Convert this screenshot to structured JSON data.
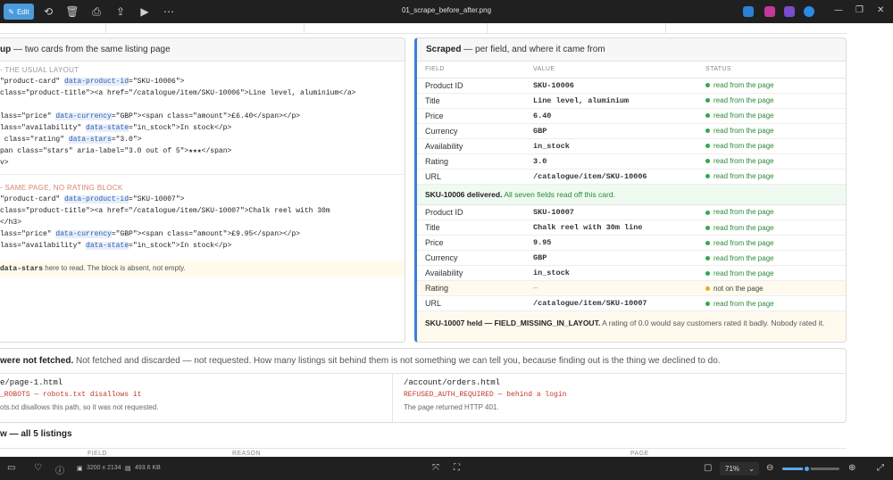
{
  "toolbar": {
    "edit_label": "Edit",
    "filename": "01_scrape_before_after.png"
  },
  "left_card": {
    "title_bold": "up",
    "title_rest": " — two cards from the same listing page",
    "section1_label": "- THE USUAL LAYOUT",
    "section1_lines": [
      [
        "\"product-card\" ",
        "data-product-id",
        "=\"SKU-10006\">"
      ],
      [
        "class=\"product-title\"><a href=\"/catalogue/item/SKU-10006\">Line level, aluminium</a>",
        "",
        ""
      ],
      [
        "",
        "",
        ""
      ],
      [
        "lass=\"price\" ",
        "data-currency",
        "=\"GBP\"><span class=\"amount\">£6.40</span></p>"
      ],
      [
        "lass=\"availability\" ",
        "data-state",
        "=\"in_stock\">In stock</p>"
      ],
      [
        " class=\"rating\" ",
        "data-stars",
        "=\"3.0\">"
      ],
      [
        "pan class=\"stars\" aria-label=\"3.0 out of 5\">★★★</span>",
        "",
        ""
      ],
      [
        "v>",
        "",
        ""
      ]
    ],
    "section2_label": "- SAME PAGE, NO RATING BLOCK",
    "section2_lines": [
      [
        "\"product-card\" ",
        "data-product-id",
        "=\"SKU-10007\">"
      ],
      [
        "class=\"product-title\"><a href=\"/catalogue/item/SKU-10007\">Chalk reel with 30m",
        "",
        ""
      ],
      [
        "</h3>",
        "",
        ""
      ],
      [
        "lass=\"price\" ",
        "data-currency",
        "=\"GBP\"><span class=\"amount\">£9.95</span></p>"
      ],
      [
        "lass=\"availability\" ",
        "data-state",
        "=\"in_stock\">In stock</p>"
      ]
    ],
    "note_code": "data-stars",
    "note_text": " here to read. The block is absent, not empty."
  },
  "right_card": {
    "title_bold": "Scraped",
    "title_rest": " — per field, and where it came from",
    "headers": [
      "FIELD",
      "VALUE",
      "STATUS"
    ],
    "group1": [
      {
        "field": "Product ID",
        "value": "SKU-10006",
        "status": "read from the page"
      },
      {
        "field": "Title",
        "value": "Line level, aluminium",
        "status": "read from the page"
      },
      {
        "field": "Price",
        "value": "6.40",
        "status": "read from the page"
      },
      {
        "field": "Currency",
        "value": "GBP",
        "status": "read from the page"
      },
      {
        "field": "Availability",
        "value": "in_stock",
        "status": "read from the page"
      },
      {
        "field": "Rating",
        "value": "3.0",
        "status": "read from the page"
      },
      {
        "field": "URL",
        "value": "/catalogue/item/SKU-10006",
        "status": "read from the page"
      }
    ],
    "delivered_bold": "SKU-10006 delivered.",
    "delivered_rest": " All seven fields read off this card.",
    "group2": [
      {
        "field": "Product ID",
        "value": "SKU-10007",
        "status": "read from the page"
      },
      {
        "field": "Title",
        "value": "Chalk reel with 30m line",
        "status": "read from the page"
      },
      {
        "field": "Price",
        "value": "9.95",
        "status": "read from the page"
      },
      {
        "field": "Currency",
        "value": "GBP",
        "status": "read from the page"
      },
      {
        "field": "Availability",
        "value": "in_stock",
        "status": "read from the page"
      },
      {
        "field": "Rating",
        "value": "—",
        "status": "not on the page"
      },
      {
        "field": "URL",
        "value": "/catalogue/item/SKU-10007",
        "status": "read from the page"
      }
    ],
    "held_bold": "SKU-10007 held — FIELD_MISSING_IN_LAYOUT.",
    "held_rest": " A rating of 0.0 would say customers rated it badly. Nobody rated it."
  },
  "bottom_card": {
    "head_bold": "were not fetched.",
    "head_rest": " Not fetched and discarded — not requested. How many listings sit behind them is not something we can tell you, because finding out is the thing we declined to do.",
    "left_path": "e/page-1.html",
    "left_reason": "_ROBOTS — robots.txt disallows it",
    "left_expl": "ots.txt disallows this path, so it was not requested.",
    "right_path": "/account/orders.html",
    "right_reason": "REFUSED_AUTH_REQUIRED — behind a login",
    "right_expl": "The page returned HTTP 401."
  },
  "summary": {
    "title": "w — all 5 listings",
    "col_field": "FIELD",
    "col_reason": "REASON",
    "col_page": "PAGE"
  },
  "statusbar": {
    "dimensions": "3200 x 2134",
    "filesize": "493.6 KB",
    "zoom": "71%",
    "zoom_level": 0.43
  }
}
